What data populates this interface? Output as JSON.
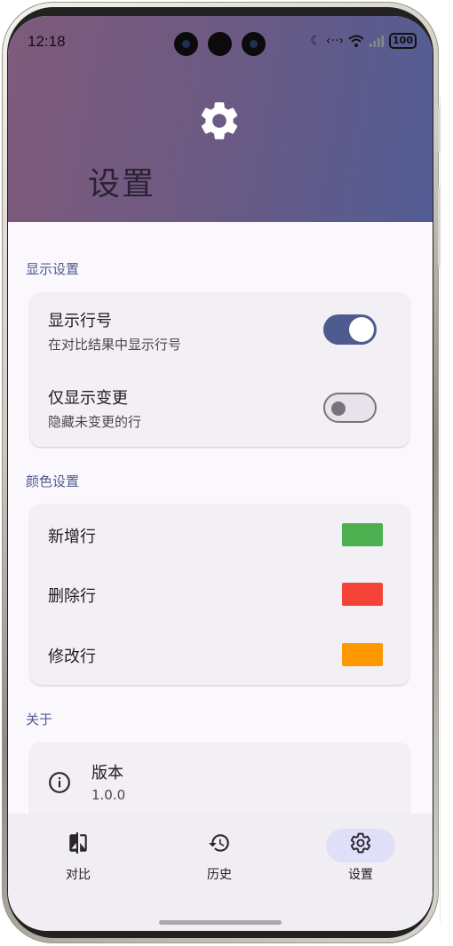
{
  "status_bar": {
    "time": "12:18",
    "icons": [
      "moon-icon",
      "data-transfer-icon",
      "wifi-icon",
      "signal-icon"
    ],
    "battery": "100"
  },
  "header": {
    "icon": "gear-icon",
    "title": "设置"
  },
  "sections": {
    "display": {
      "label": "显示设置",
      "items": [
        {
          "title": "显示行号",
          "subtitle": "在对比结果中显示行号",
          "enabled": true
        },
        {
          "title": "仅显示变更",
          "subtitle": "隐藏未变更的行",
          "enabled": false
        }
      ]
    },
    "colors": {
      "label": "颜色设置",
      "items": [
        {
          "title": "新增行",
          "color": "#4caf50"
        },
        {
          "title": "删除行",
          "color": "#f44336"
        },
        {
          "title": "修改行",
          "color": "#ff9800"
        }
      ]
    },
    "about": {
      "label": "关于",
      "version_title": "版本",
      "version_value": "1.0.0",
      "icon": "info-icon"
    }
  },
  "bottom_nav": {
    "items": [
      {
        "label": "对比",
        "icon": "compare-icon",
        "selected": false
      },
      {
        "label": "历史",
        "icon": "history-icon",
        "selected": false
      },
      {
        "label": "设置",
        "icon": "gear-icon",
        "selected": true
      }
    ]
  },
  "colors": {
    "accent": "#4e5b8f",
    "header_gradient_start": "#7f5a7b",
    "header_gradient_end": "#525c94",
    "nav_selected_pill": "#dfe0f7"
  }
}
